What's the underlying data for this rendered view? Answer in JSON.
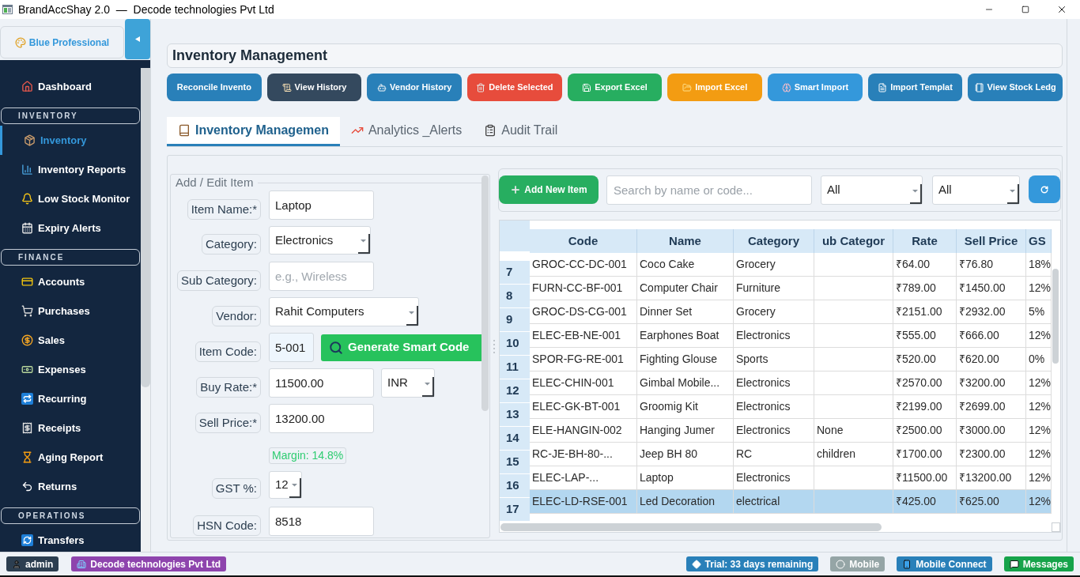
{
  "window": {
    "title": "BrandAccShay 2.0  —  Decode technologies Pvt Ltd"
  },
  "sidebar": {
    "theme_button": "Blue Professional",
    "nav": [
      {
        "kind": "item",
        "label": "Dashboard",
        "selected": false
      },
      {
        "kind": "section",
        "label": "INVENTORY"
      },
      {
        "kind": "item",
        "label": "Inventory",
        "selected": true
      },
      {
        "kind": "item",
        "label": "Inventory Reports",
        "selected": false
      },
      {
        "kind": "item",
        "label": "Low Stock Monitor",
        "selected": false
      },
      {
        "kind": "item",
        "label": "Expiry Alerts",
        "selected": false
      },
      {
        "kind": "section",
        "label": "FINANCE"
      },
      {
        "kind": "item",
        "label": "Accounts",
        "selected": false
      },
      {
        "kind": "item",
        "label": "Purchases",
        "selected": false
      },
      {
        "kind": "item",
        "label": "Sales",
        "selected": false
      },
      {
        "kind": "item",
        "label": "Expenses",
        "selected": false
      },
      {
        "kind": "item",
        "label": "Recurring",
        "selected": false
      },
      {
        "kind": "item",
        "label": "Receipts",
        "selected": false
      },
      {
        "kind": "item",
        "label": "Aging Report",
        "selected": false
      },
      {
        "kind": "item",
        "label": "Returns",
        "selected": false
      },
      {
        "kind": "section",
        "label": "OPERATIONS"
      },
      {
        "kind": "item",
        "label": "Transfers",
        "selected": false
      }
    ]
  },
  "page": {
    "title": "Inventory Management"
  },
  "toolbar": [
    {
      "label": "Reconcile Invento",
      "color": "#2980b9"
    },
    {
      "label": "View History",
      "color": "#34495e"
    },
    {
      "label": "Vendor History",
      "color": "#2980b9"
    },
    {
      "label": "Delete Selected",
      "color": "#e74c3c"
    },
    {
      "label": "Export Excel",
      "color": "#27ae60"
    },
    {
      "label": "Import Excel",
      "color": "#f39c12"
    },
    {
      "label": "Smart Import",
      "color": "#3498db"
    },
    {
      "label": "Import Templat",
      "color": "#2980b9"
    },
    {
      "label": "View Stock Ledg",
      "color": "#2980b9"
    }
  ],
  "tabs": [
    {
      "label": "Inventory Managemen",
      "selected": true
    },
    {
      "label": "Analytics _Alerts",
      "selected": false
    },
    {
      "label": "Audit Trail",
      "selected": false
    }
  ],
  "form": {
    "legend": "Add / Edit Item",
    "fields": [
      {
        "kind": "input",
        "label": "Item Name:*",
        "value": "Laptop"
      },
      {
        "kind": "select",
        "label": "Category:",
        "value": "Electronics"
      },
      {
        "kind": "input",
        "label": "Sub Category:",
        "placeholder": "e.g., Wireless"
      },
      {
        "kind": "select",
        "label": "Vendor:",
        "value": "Rahit Computers"
      },
      {
        "kind": "code",
        "label": "Item Code:",
        "value": "5-001",
        "button": "Generate Smart Code"
      },
      {
        "kind": "currency",
        "label": "Buy Rate:*",
        "value": "11500.00",
        "currency": "INR"
      },
      {
        "kind": "input",
        "label": "Sell Price:*",
        "value": "13200.00"
      },
      {
        "kind": "note",
        "value": "Margin: 14.8%"
      },
      {
        "kind": "select",
        "label": "GST %:",
        "value": "12"
      },
      {
        "kind": "input",
        "label": "HSN Code:",
        "value": "8518"
      }
    ]
  },
  "items_panel": {
    "add_button": "Add New Item",
    "search": {
      "placeholder": "Search by name or code..."
    },
    "filters": [
      {
        "value": "All"
      },
      {
        "value": "All"
      }
    ],
    "table": {
      "columns": [
        "Code",
        "Name",
        "Category",
        "ub Categor",
        "Rate",
        "Sell Price",
        "GS"
      ],
      "rows": [
        {
          "number": "7",
          "code": "GROC-CC-DC-001",
          "name": "Coco Cake",
          "category": "Grocery",
          "rate": "₹64.00",
          "sell_price": "₹76.80",
          "gst": "18%",
          "selected": false
        },
        {
          "number": "8",
          "code": "FURN-CC-BF-001",
          "name": "Computer Chair",
          "category": "Furniture",
          "rate": "₹789.00",
          "sell_price": "₹1450.00",
          "gst": "12%",
          "selected": false
        },
        {
          "number": "9",
          "code": "GROC-DS-CG-001",
          "name": "Dinner Set",
          "category": "Grocery",
          "rate": "₹2151.00",
          "sell_price": "₹2932.00",
          "gst": "5%",
          "selected": false
        },
        {
          "number": "10",
          "code": "ELEC-EB-NE-001",
          "name": "Earphones Boat",
          "category": "Electronics",
          "rate": "₹555.00",
          "sell_price": "₹666.00",
          "gst": "12%",
          "selected": false
        },
        {
          "number": "11",
          "code": "SPOR-FG-RE-001",
          "name": "Fighting Glouse",
          "category": "Sports",
          "rate": "₹520.00",
          "sell_price": "₹620.00",
          "gst": "0%",
          "selected": false
        },
        {
          "number": "12",
          "code": "ELEC-CHIN-001",
          "name": "Gimbal Mobile...",
          "category": "Electronics",
          "rate": "₹2570.00",
          "sell_price": "₹3200.00",
          "gst": "12%",
          "selected": false
        },
        {
          "number": "13",
          "code": "ELEC-GK-BT-001",
          "name": "Groomig Kit",
          "category": "Electronics",
          "rate": "₹2199.00",
          "sell_price": "₹2699.00",
          "gst": "12%",
          "selected": false
        },
        {
          "number": "14",
          "code": "ELE-HANGIN-002",
          "name": "Hanging Jumer",
          "category": "Electronics",
          "sub_category": "None",
          "rate": "₹2500.00",
          "sell_price": "₹3000.00",
          "gst": "12%",
          "selected": false
        },
        {
          "number": "15",
          "code": "RC-JE-BH-80-...",
          "name": "Jeep BH 80",
          "category": "RC",
          "sub_category": "children",
          "rate": "₹1700.00",
          "sell_price": "₹2300.00",
          "gst": "12%",
          "selected": false
        },
        {
          "number": "16",
          "code": "ELEC-LAP-...",
          "name": "Laptop",
          "category": "Electronics",
          "rate": "₹11500.00",
          "sell_price": "₹13200.00",
          "gst": "12%",
          "selected": false
        },
        {
          "number": "17",
          "code": "ELEC-LD-RSE-001",
          "name": "Led Decoration",
          "category": "electrical",
          "rate": "₹425.00",
          "sell_price": "₹625.00",
          "gst": "12%",
          "selected": true
        }
      ]
    }
  },
  "status_bar": {
    "left": [
      {
        "label": "admin",
        "color": "#2c3e50"
      },
      {
        "label": "Decode technologies Pvt Ltd",
        "color": "#8e44ad"
      }
    ],
    "right": [
      {
        "label": "Trial: 33 days remaining",
        "color": "#2980b9"
      },
      {
        "label": "Mobile",
        "color": "#95a5a6"
      },
      {
        "label": "Mobile Connect",
        "color": "#2980b9"
      },
      {
        "label": "Messages",
        "color": "#16a34a"
      }
    ]
  }
}
